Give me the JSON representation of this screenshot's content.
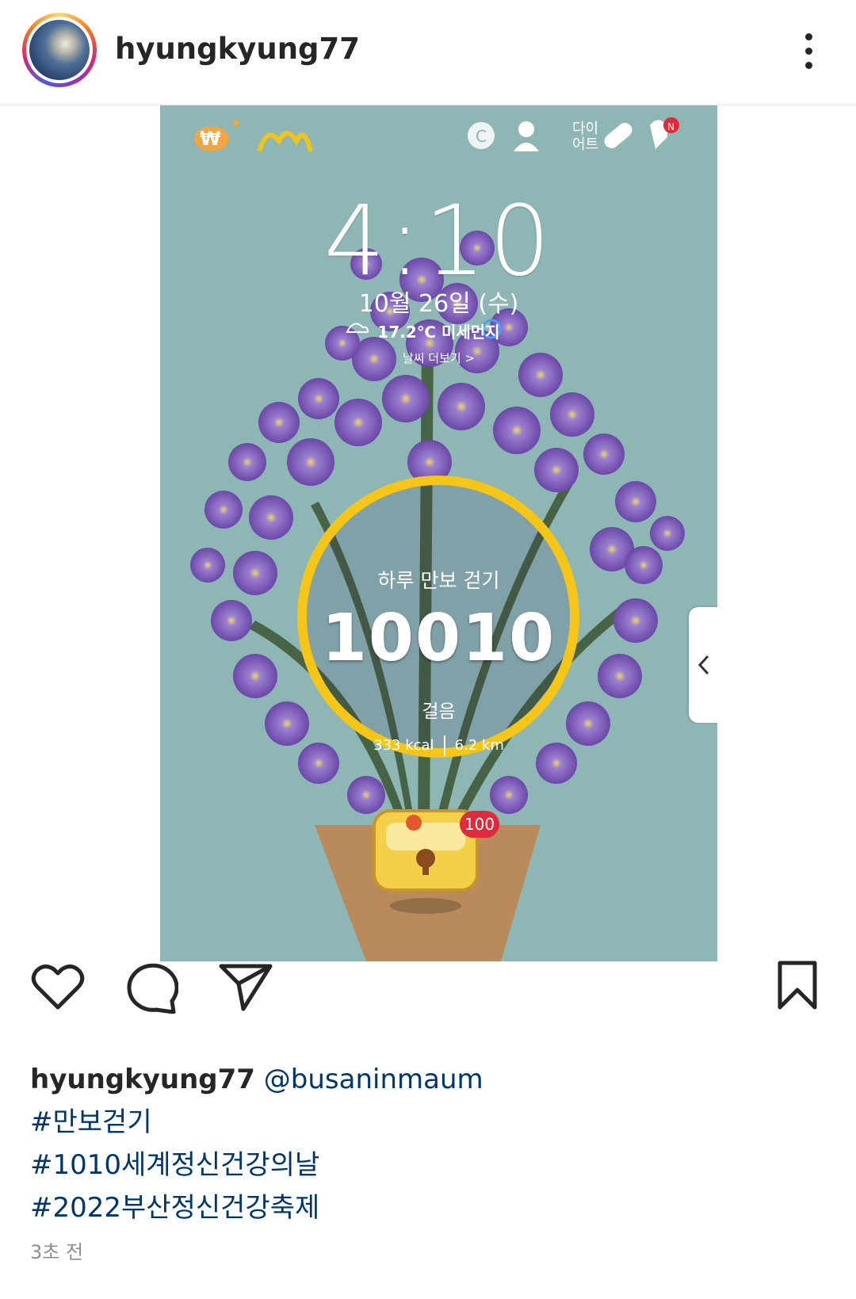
{
  "post": {
    "username": "hyungkyung77",
    "avatar_icon": "profile-photo-night-tree"
  },
  "lockscreen": {
    "clock": "4:10",
    "date": "10월 26일 (수)",
    "weather": "17.2℃ 미세먼지",
    "weather_more": "날씨 더보기 >",
    "diet_label_line1": "다이",
    "diet_label_line2": "어트",
    "walk_title": "하루 만보 걷기",
    "steps": "10010",
    "steps_unit": "걸음",
    "kcal": "333 kcal",
    "distance": "6.2 km",
    "reward_count": "100",
    "ring_color": "#f5c518",
    "background_color": "#8eb6b5",
    "flower_color": "#7b5bb5"
  },
  "caption": {
    "username": "hyungkyung77",
    "mention": "@busaninmaum",
    "hashtags": [
      "#만보걷기",
      "#1010세계정신건강의날",
      "#2022부산정신건강축제"
    ]
  },
  "timestamp": "3초 전"
}
